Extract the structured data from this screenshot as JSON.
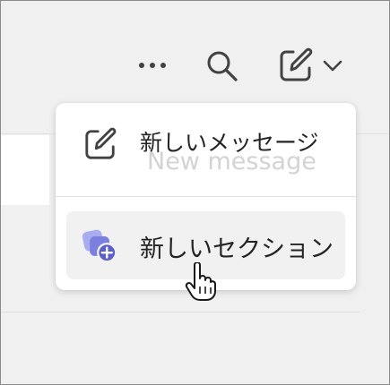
{
  "toolbar": {
    "more_icon": "more-horizontal-icon",
    "search_icon": "search-icon",
    "compose_icon": "compose-icon",
    "compose_dropdown_icon": "chevron-down-icon"
  },
  "menu": {
    "items": [
      {
        "label": "新しいメッセージ",
        "ghost_text": "New message",
        "icon": "compose-icon"
      },
      {
        "label": "新しいセクション",
        "icon": "new-section-icon"
      }
    ]
  },
  "colors": {
    "icon_gray": "#424242",
    "section_icon_purple": "#5b5fc7",
    "section_icon_light": "#a9acef",
    "hover_background": "#f1f1f1"
  }
}
